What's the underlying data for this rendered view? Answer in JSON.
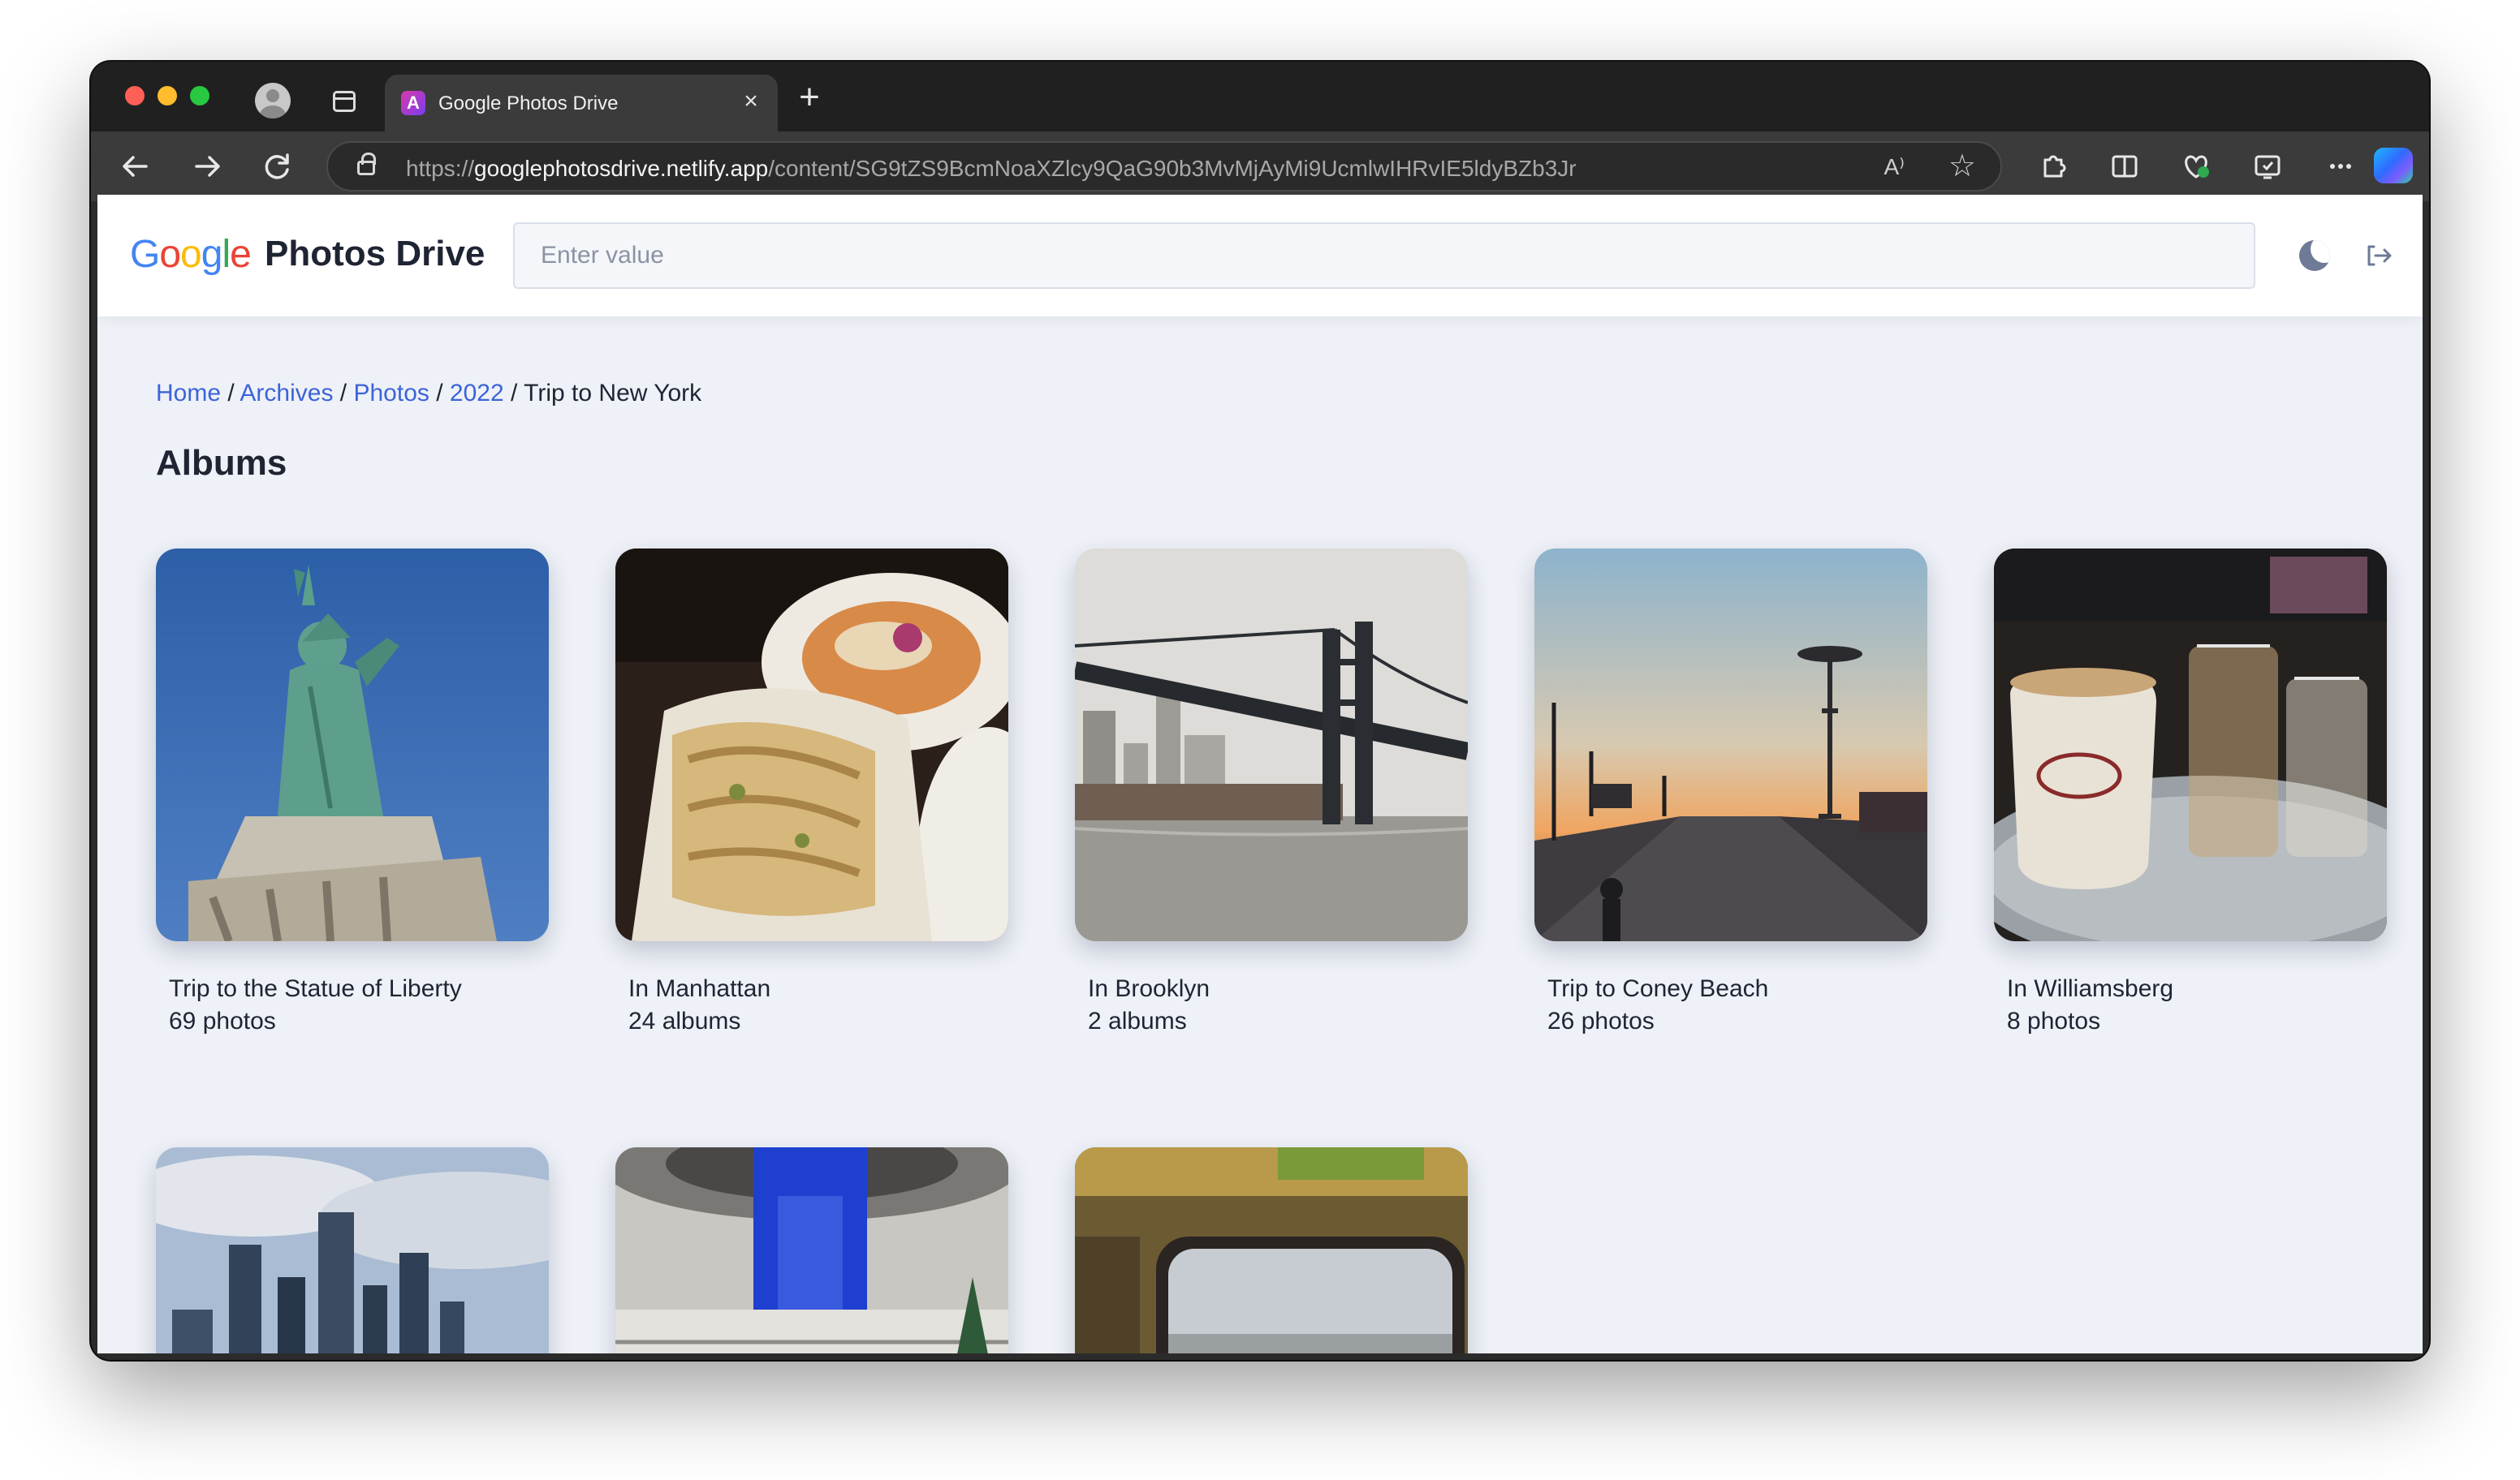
{
  "browser": {
    "tab_title": "Google Photos Drive",
    "url_scheme": "https://",
    "url_host": "googlephotosdrive.netlify.app",
    "url_path": "/content/SG9tZS9BcmNoaXZlcy9QaG90b3MvMjAyMi9UcmlwIHRvIE5ldyBZb3Jr",
    "read_aloud_glyph": "A⁾",
    "star_glyph": "☆",
    "new_tab_glyph": "+",
    "close_glyph": "×"
  },
  "header": {
    "logo_letters": [
      "G",
      "o",
      "o",
      "g",
      "l",
      "e"
    ],
    "app_name": "Photos Drive",
    "search_placeholder": "Enter value"
  },
  "breadcrumb": {
    "items": [
      "Home",
      "Archives",
      "Photos",
      "2022"
    ],
    "current": "Trip to New York",
    "separator": "/"
  },
  "section_title": "Albums",
  "albums": [
    {
      "title": "Trip to the Statue of Liberty",
      "subtitle": "69 photos",
      "thumb": "statue-of-liberty"
    },
    {
      "title": "In Manhattan",
      "subtitle": "24 albums",
      "thumb": "food-plate"
    },
    {
      "title": "In Brooklyn",
      "subtitle": "2 albums",
      "thumb": "manhattan-bridge"
    },
    {
      "title": "Trip to Coney Beach",
      "subtitle": "26 photos",
      "thumb": "boardwalk-sunset"
    },
    {
      "title": "In Williamsberg",
      "subtitle": "8 photos",
      "thumb": "coffee-tray"
    },
    {
      "thumb": "city-skyline"
    },
    {
      "thumb": "mall-atrium"
    },
    {
      "thumb": "train-window"
    }
  ],
  "colors": {
    "link": "#3c64d8",
    "text": "#1f2433",
    "page_bg": "#eef1f7"
  }
}
